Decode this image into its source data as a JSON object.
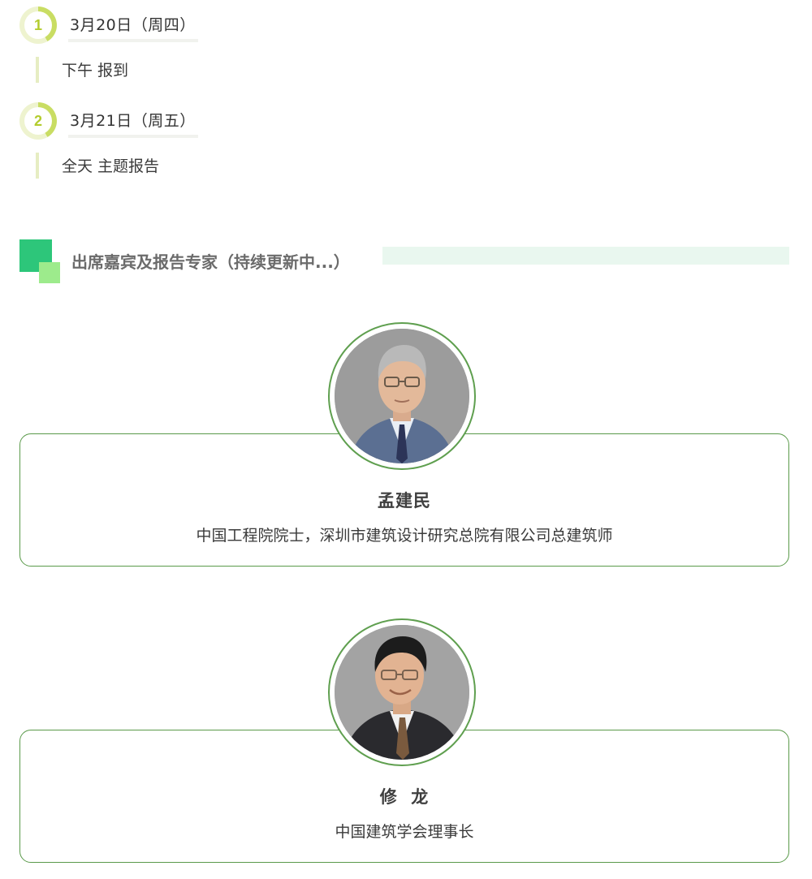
{
  "schedule": [
    {
      "number": "1",
      "date": "3月20日（周四）",
      "detail": "下午 报到"
    },
    {
      "number": "2",
      "date": "3月21日（周五）",
      "detail": "全天 主题报告"
    }
  ],
  "section": {
    "title": "出席嘉宾及报告专家（持续更新中...）"
  },
  "guests": [
    {
      "name": "孟建民",
      "title": "中国工程院院士，深圳市建筑设计研究总院有限公司总建筑师",
      "photo_icon": "portrait-photo"
    },
    {
      "name": "修  龙",
      "title": "中国建筑学会理事长",
      "photo_icon": "portrait-photo"
    }
  ],
  "colors": {
    "accent_green": "#2dc67a",
    "light_green": "#9deb8c",
    "card_border": "#5a9a4a",
    "badge_yellow_green": "#b3cc2e"
  }
}
